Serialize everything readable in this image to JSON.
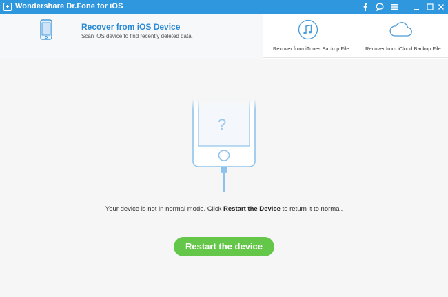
{
  "titlebar": {
    "title": "Wondershare Dr.Fone for iOS",
    "icons": [
      "facebook-icon",
      "feedback-icon",
      "menu-icon",
      "minimize-icon",
      "close-icon"
    ]
  },
  "modes": {
    "active": {
      "title": "Recover from iOS Device",
      "description": "Scan iOS device to find recently deleted data."
    },
    "itunes": {
      "label": "Recover from iTunes Backup File"
    },
    "icloud": {
      "label": "Recover from iCloud Backup File"
    }
  },
  "main": {
    "message_prefix": "Your device is not in normal mode. Click ",
    "message_bold": "Restart the Device",
    "message_suffix": " to return it to normal.",
    "restart_button": "Restart the device",
    "device_symbol": "?"
  },
  "colors": {
    "titlebar": "#2f97de",
    "accent": "#2b8ad3",
    "button": "#65c74a",
    "device_outline": "#8fc3ec"
  }
}
